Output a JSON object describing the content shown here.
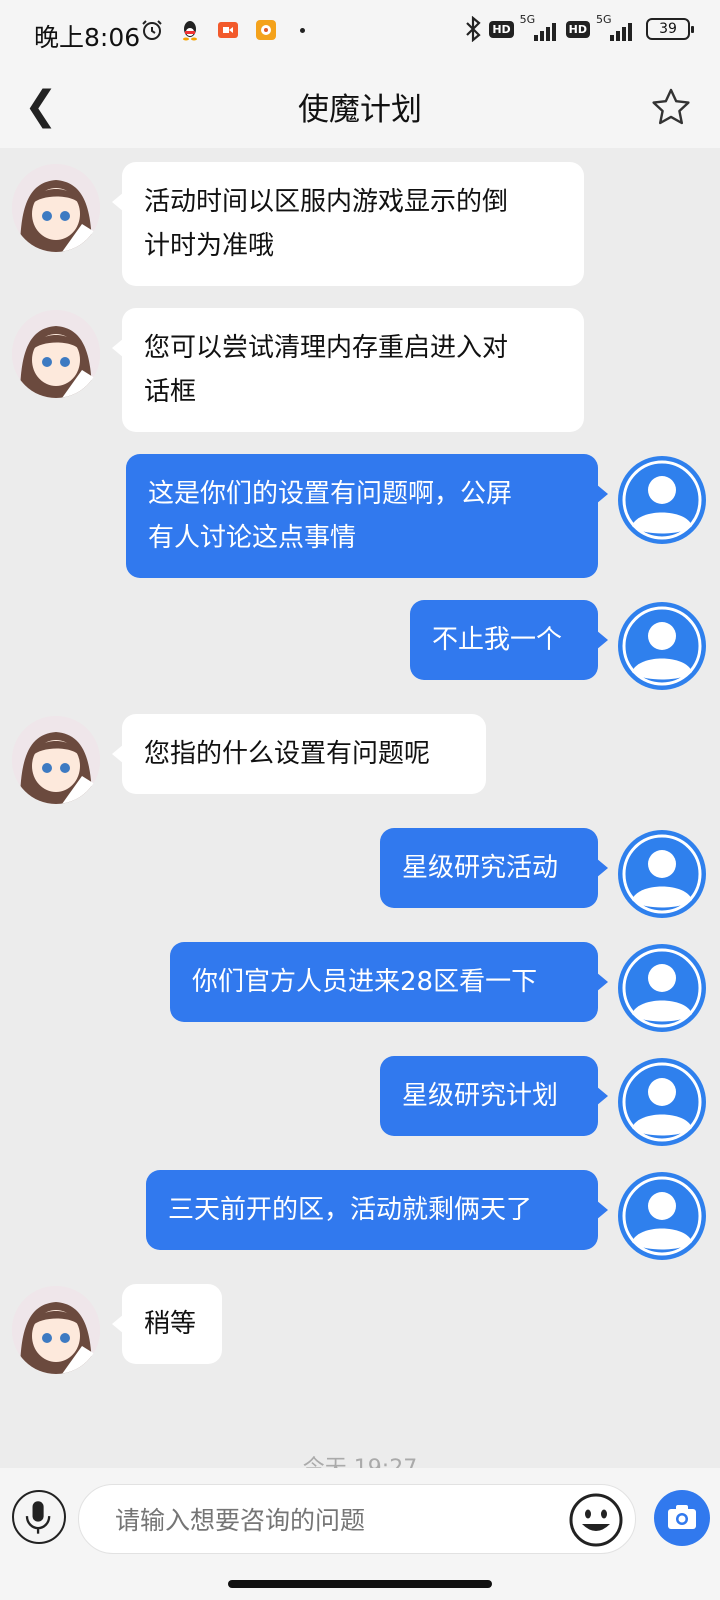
{
  "status_bar": {
    "time": "晚上8:06",
    "network_1": "5G",
    "network_2": "5G",
    "hd_1": "HD",
    "hd_2": "HD",
    "battery": "39"
  },
  "header": {
    "back_icon": "chevron-left-icon",
    "back_glyph": "❮",
    "title": "使魔计划",
    "favorite_icon": "star-outline-icon"
  },
  "messages": [
    {
      "from": "bot",
      "text_lines": [
        "活动时间以区服内游戏显示的倒",
        "计时为准哦"
      ]
    },
    {
      "from": "bot",
      "text_lines": [
        "您可以尝试清理内存重启进入对",
        "话框"
      ]
    },
    {
      "from": "user",
      "text_lines": [
        "这是你们的设置有问题啊，公屏",
        "有人讨论这点事情"
      ]
    },
    {
      "from": "user",
      "text_lines": [
        "不止我一个"
      ]
    },
    {
      "from": "bot",
      "text_lines": [
        "您指的什么设置有问题呢"
      ]
    },
    {
      "from": "user",
      "text_lines": [
        "星级研究活动"
      ]
    },
    {
      "from": "user",
      "text_lines": [
        "你们官方人员进来28区看一下"
      ]
    },
    {
      "from": "user",
      "text_lines": [
        "星级研究计划"
      ]
    },
    {
      "from": "user",
      "text_lines": [
        "三天前开的区，活动就剩俩天了"
      ]
    },
    {
      "from": "bot",
      "text_lines": [
        "稍等"
      ]
    }
  ],
  "timestamp": "今天 19:27",
  "input_bar": {
    "placeholder": "请输入想要咨询的问题",
    "mic_icon": "microphone-icon",
    "emoji_icon": "emoji-icon",
    "camera_icon": "camera-icon"
  },
  "colors": {
    "user_bubble": "#3179ee",
    "bot_bubble": "#ffffff",
    "background": "#ececec"
  }
}
